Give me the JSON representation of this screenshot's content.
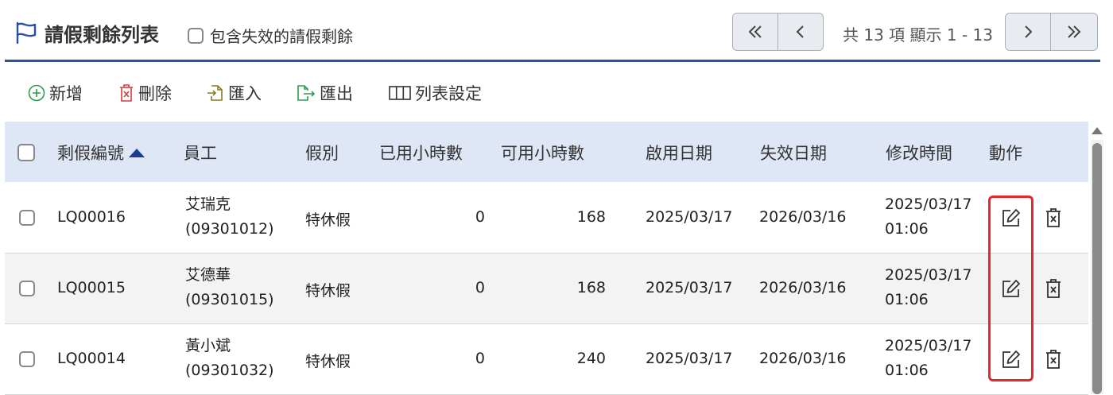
{
  "header": {
    "title": "請假剩餘列表",
    "include_expired_label": "包含失效的請假剩餘",
    "pager_info": "共 13 項 顯示 1 - 13"
  },
  "toolbar": {
    "add": "新增",
    "delete": "刪除",
    "import": "匯入",
    "export": "匯出",
    "column_settings": "列表設定"
  },
  "table": {
    "columns": {
      "id": "剩假編號",
      "employee": "員工",
      "leave_type": "假別",
      "used_hours": "已用小時數",
      "available_hours": "可用小時數",
      "start_date": "啟用日期",
      "end_date": "失效日期",
      "modified": "修改時間",
      "actions": "動作"
    },
    "rows": [
      {
        "id": "LQ00016",
        "employee_name": "艾瑞克",
        "employee_no": "(09301012)",
        "leave_type": "特休假",
        "used_hours": "0",
        "available_hours": "168",
        "start_date": "2025/03/17",
        "end_date": "2026/03/16",
        "modified_date": "2025/03/17",
        "modified_time": "01:06"
      },
      {
        "id": "LQ00015",
        "employee_name": "艾德華",
        "employee_no": "(09301015)",
        "leave_type": "特休假",
        "used_hours": "0",
        "available_hours": "168",
        "start_date": "2025/03/17",
        "end_date": "2026/03/16",
        "modified_date": "2025/03/17",
        "modified_time": "01:06"
      },
      {
        "id": "LQ00014",
        "employee_name": "黃小斌",
        "employee_no": "(09301032)",
        "leave_type": "特休假",
        "used_hours": "0",
        "available_hours": "240",
        "start_date": "2025/03/17",
        "end_date": "2026/03/16",
        "modified_date": "2025/03/17",
        "modified_time": "01:06"
      }
    ]
  },
  "icons": {
    "title": "flag-icon",
    "first_page": "double-chevron-left-icon",
    "prev_page": "chevron-left-icon",
    "next_page": "chevron-right-icon",
    "last_page": "double-chevron-right-icon",
    "add": "plus-circle-icon",
    "delete": "trash-x-icon",
    "import": "file-import-icon",
    "export": "file-export-icon",
    "column_settings": "columns-icon",
    "edit": "pencil-square-icon",
    "row_delete": "trash-x-icon"
  },
  "colors": {
    "accent": "#2a50a0",
    "header_row_bg": "#dfe6f5",
    "highlight": "#e8262e",
    "add_icon": "#2e9b4e",
    "delete_icon": "#d83a3a",
    "import_icon": "#8a7a1e",
    "export_icon": "#2e9b4e"
  }
}
